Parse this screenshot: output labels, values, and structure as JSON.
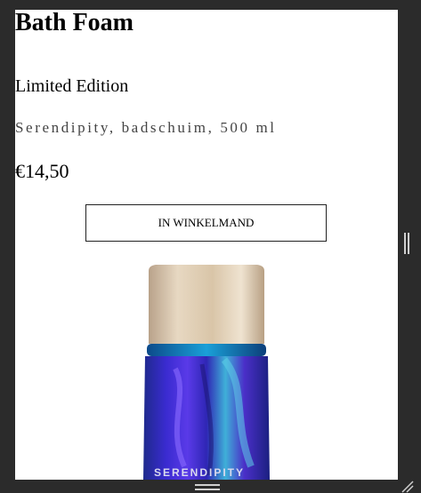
{
  "product": {
    "title": "Bath Foam",
    "subtitle": "Limited Edition",
    "description": "Serendipity, badschuim, 500 ml",
    "price": "€14,50",
    "add_to_cart_label": "IN WINKELMAND",
    "bottle_label": "SERENDIPITY"
  },
  "colors": {
    "background_chrome": "#2b2b2b",
    "page_background": "#ffffff",
    "cap_gold": "#d8c3a5",
    "bottle_blue": "#3b22b8"
  },
  "icons": {
    "scroll_handle": "vertical-grip-icon",
    "bottom_grip": "horizontal-grip-icon",
    "resize": "resize-corner-icon"
  }
}
